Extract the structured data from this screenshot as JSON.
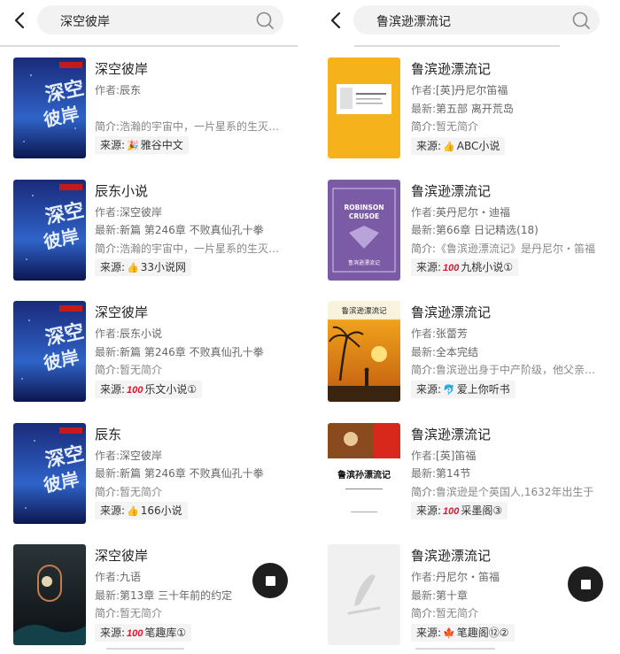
{
  "colors": {
    "accent_red": "#e0142c",
    "fab_bg": "#1e1e1e",
    "search_bg": "#f2f2f2"
  },
  "left": {
    "search": {
      "query": "深空彼岸"
    },
    "items": [
      {
        "title": "深空彼岸",
        "author_label": "作者:",
        "author": "辰东",
        "latest_label": "",
        "latest": "",
        "desc_label": "简介:",
        "desc": "浩瀚的宇宙中，一片星系的生灭，也不过是刹那的斑驳流光。",
        "source_label": "来源:",
        "source_icon": "party-popper-icon",
        "source_glyph": "🎉",
        "source": "雅谷中文"
      },
      {
        "title": "辰东小说",
        "author_label": "作者:",
        "author": "深空彼岸",
        "latest_label": "最新:",
        "latest": "新篇 第246章 不败真仙孔十拳",
        "desc_label": "简介:",
        "desc": "浩瀚的宇宙中，一片星系的生灭，也不过是刹那的斑驳流光。",
        "source_label": "来源:",
        "source_icon": "thumbs-up-icon",
        "source_glyph": "👍",
        "source": "33小说网"
      },
      {
        "title": "深空彼岸",
        "author_label": "作者:",
        "author": "辰东小说",
        "latest_label": "最新:",
        "latest": "新篇 第246章 不败真仙孔十拳",
        "desc_label": "简介:",
        "desc": "暂无简介",
        "source_label": "来源:",
        "source_icon": "hundred-points-icon",
        "source_glyph": "100",
        "source": "乐文小说①"
      },
      {
        "title": "辰东",
        "author_label": "作者:",
        "author": "深空彼岸",
        "latest_label": "最新:",
        "latest": "新篇 第246章 不败真仙孔十拳",
        "desc_label": "简介:",
        "desc": "暂无简介",
        "source_label": "来源:",
        "source_icon": "thumbs-up-icon",
        "source_glyph": "👍",
        "source": "166小说"
      },
      {
        "title": "深空彼岸",
        "author_label": "作者:",
        "author": "九语",
        "latest_label": "最新:",
        "latest": "第13章 三十年前的约定",
        "desc_label": "简介:",
        "desc": "暂无简介",
        "source_label": "来源:",
        "source_icon": "hundred-points-icon",
        "source_glyph": "100",
        "source": "笔趣库①"
      }
    ]
  },
  "right": {
    "search": {
      "query": "鲁滨逊漂流记"
    },
    "items": [
      {
        "title": "鲁滨逊漂流记",
        "author_label": "作者:",
        "author": "[英]丹尼尔笛福",
        "latest_label": "最新:",
        "latest": "第五部 离开荒岛",
        "desc_label": "简介:",
        "desc": "暂无简介",
        "source_label": "来源:",
        "source_icon": "thumbs-up-icon",
        "source_glyph": "👍",
        "source": "ABC小说"
      },
      {
        "title": "鲁滨逊漂流记",
        "author_label": "作者:",
        "author": "英丹尼尔・迪福",
        "latest_label": "最新:",
        "latest": "第66章 日记精选(18)",
        "desc_label": "简介:",
        "desc": "《鲁滨逊漂流记》是丹尼尔・笛福",
        "source_label": "来源:",
        "source_icon": "hundred-points-icon",
        "source_glyph": "100",
        "source": "九桃小说①"
      },
      {
        "title": "鲁滨逊漂流记",
        "author_label": "作者:",
        "author": "张蕾芳",
        "latest_label": "最新:",
        "latest": "全本完结",
        "desc_label": "简介:",
        "desc": "鲁滨逊出身于中产阶级，他父亲希望他",
        "source_label": "来源:",
        "source_icon": "dolphin-icon",
        "source_glyph": "🐬",
        "source": "爱上你听书"
      },
      {
        "title": "鲁滨逊漂流记",
        "author_label": "作者:",
        "author": "[英]笛福",
        "latest_label": "最新:",
        "latest": "第14节",
        "desc_label": "简介:",
        "desc": "鲁滨逊是个英国人,1632年出生于",
        "source_label": "来源:",
        "source_icon": "hundred-points-icon",
        "source_glyph": "100",
        "source": "采墨阁③"
      },
      {
        "title": "鲁滨逊漂流记",
        "author_label": "作者:",
        "author": "丹尼尔・笛福",
        "latest_label": "最新:",
        "latest": "第十章",
        "desc_label": "简介:",
        "desc": "暂无简介",
        "source_label": "来源:",
        "source_icon": "maple-leaf-icon",
        "source_glyph": "🍁",
        "source": "笔趣阁⑫②"
      }
    ]
  },
  "covers": {
    "left_top_text": "九州出版",
    "right_2_title": "ROBINSON CRUSOE",
    "right_2_sub": "鲁滨逊漂流记",
    "right_3_title": "鲁滨逊漂流记",
    "right_4_title": "鲁滨孙漂流记"
  }
}
